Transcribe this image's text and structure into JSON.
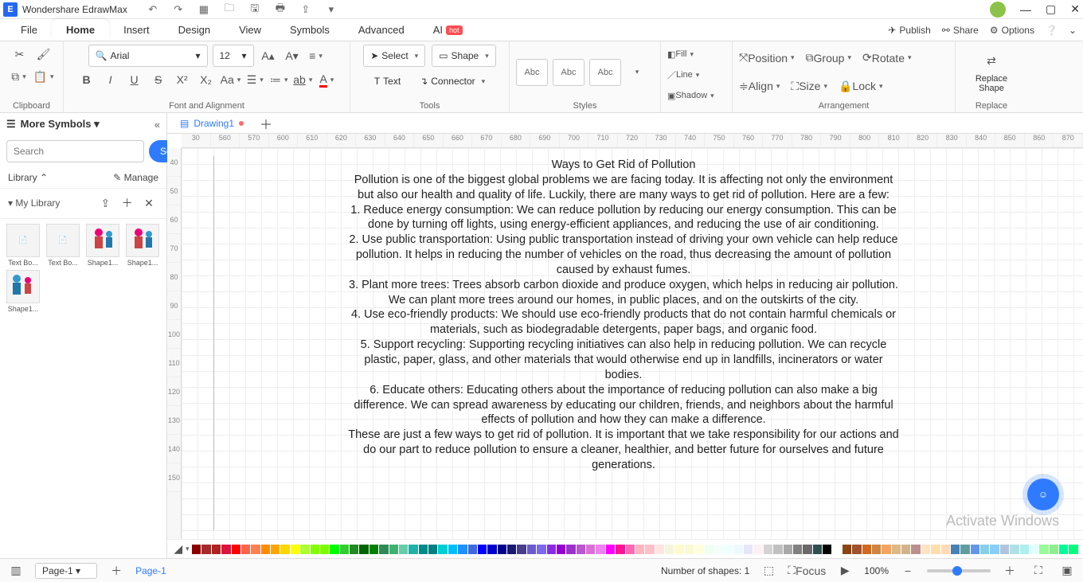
{
  "app": {
    "title": "Wondershare EdrawMax"
  },
  "window_controls": {
    "min": "—",
    "max": "▢",
    "close": "✕"
  },
  "menu": {
    "items": [
      "File",
      "Home",
      "Insert",
      "Design",
      "View",
      "Symbols",
      "Advanced",
      "AI"
    ],
    "active": "Home",
    "ai_badge": "hot",
    "right": {
      "publish": "Publish",
      "share": "Share",
      "options": "Options"
    }
  },
  "ribbon": {
    "clipboard": {
      "label": "Clipboard"
    },
    "font": {
      "label": "Font and Alignment",
      "name": "Arial",
      "size": "12"
    },
    "tools": {
      "label": "Tools",
      "select": "Select",
      "shape": "Shape",
      "text": "Text",
      "connector": "Connector"
    },
    "styles": {
      "label": "Styles",
      "items": [
        "Abc",
        "Abc",
        "Abc"
      ]
    },
    "shape_props": {
      "fill": "Fill",
      "line": "Line",
      "shadow": "Shadow"
    },
    "arrangement": {
      "label": "Arrangement",
      "position": "Position",
      "align": "Align",
      "group": "Group",
      "size": "Size",
      "rotate": "Rotate",
      "lock": "Lock"
    },
    "replace": {
      "label": "Replace",
      "btn": "Replace Shape"
    }
  },
  "sidebar": {
    "title": "More Symbols",
    "search_placeholder": "Search",
    "search_btn": "Search",
    "library": "Library",
    "manage": "Manage",
    "mylib": "My Library",
    "thumbs": [
      "Text Bo...",
      "Text Bo...",
      "Shape1...",
      "Shape1...",
      "Shape1..."
    ]
  },
  "doc_tabs": {
    "drawing": "Drawing1"
  },
  "ruler_h": [
    "30",
    "560",
    "570",
    "600",
    "610",
    "620",
    "630",
    "640",
    "650",
    "660",
    "670",
    "680",
    "690",
    "700",
    "710",
    "720",
    "730",
    "740",
    "750",
    "760",
    "770",
    "780",
    "790",
    "800",
    "810",
    "820",
    "830",
    "840",
    "850",
    "860",
    "870"
  ],
  "ruler_v": [
    "40",
    "50",
    "60",
    "70",
    "80",
    "90",
    "100",
    "110",
    "120",
    "130",
    "140",
    "150"
  ],
  "essay": {
    "title": "Ways to Get Rid of Pollution",
    "p1": "Pollution is one of the biggest global problems we are facing today. It is affecting not only the environment but also our health and quality of life. Luckily, there are many ways to get rid of pollution. Here are a few:",
    "p2": "1. Reduce energy consumption: We can reduce pollution by reducing our energy consumption. This can be done by turning off lights, using energy-efficient appliances, and reducing the use of air conditioning.",
    "p3": "2. Use public transportation: Using public transportation instead of driving your own vehicle can help reduce pollution. It helps in reducing the number of vehicles on the road, thus decreasing the amount of pollution caused by exhaust fumes.",
    "p4": "3. Plant more trees: Trees absorb carbon dioxide and produce oxygen, which helps in reducing air pollution. We can plant more trees around our homes, in public places, and on the outskirts of the city.",
    "p5": "4. Use eco-friendly products: We should use eco-friendly products that do not contain harmful chemicals or materials, such as biodegradable detergents, paper bags, and organic food.",
    "p6": "5. Support recycling: Supporting recycling initiatives can also help in reducing pollution. We can recycle plastic, paper, glass, and other materials that would otherwise end up in landfills, incinerators or water bodies.",
    "p7": "6. Educate others: Educating others about the importance of reducing pollution can also make a big difference. We can spread awareness by educating our children, friends, and neighbors about the harmful effects of pollution and how they can make a difference.",
    "p8": "These are just a few ways to get rid of pollution. It is important that we take responsibility for our actions and do our part to reduce pollution to ensure a cleaner, healthier, and better future for ourselves and future generations."
  },
  "watermark": "Activate Windows",
  "status": {
    "page_sel": "Page-1",
    "page_tab": "Page-1",
    "shapes_label": "Number of shapes:",
    "shapes_count": "1",
    "focus": "Focus",
    "zoom": "100%"
  },
  "colors": [
    "#8B0000",
    "#A52A2A",
    "#B22222",
    "#DC143C",
    "#FF0000",
    "#FF6347",
    "#FF7F50",
    "#FF8C00",
    "#FFA500",
    "#FFD700",
    "#FFFF00",
    "#ADFF2F",
    "#7FFF00",
    "#7CFC00",
    "#00FF00",
    "#32CD32",
    "#228B22",
    "#006400",
    "#008000",
    "#2E8B57",
    "#3CB371",
    "#66CDAA",
    "#20B2AA",
    "#008B8B",
    "#008080",
    "#00CED1",
    "#00BFFF",
    "#1E90FF",
    "#4169E1",
    "#0000FF",
    "#0000CD",
    "#00008B",
    "#191970",
    "#483D8B",
    "#6A5ACD",
    "#7B68EE",
    "#8A2BE2",
    "#9400D3",
    "#9932CC",
    "#BA55D3",
    "#DA70D6",
    "#EE82EE",
    "#FF00FF",
    "#FF1493",
    "#FF69B4",
    "#FFB6C1",
    "#FFC0CB",
    "#FFE4E1",
    "#F5F5DC",
    "#FFFACD",
    "#FAFAD2",
    "#FFFFE0",
    "#F0FFF0",
    "#F5FFFA",
    "#F0FFFF",
    "#F0F8FF",
    "#E6E6FA",
    "#FFF0F5",
    "#D3D3D3",
    "#C0C0C0",
    "#A9A9A9",
    "#808080",
    "#696969",
    "#2F4F4F",
    "#000000",
    "#FFFFFF",
    "#8B4513",
    "#A0522D",
    "#D2691E",
    "#CD853F",
    "#F4A460",
    "#DEB887",
    "#D2B48C",
    "#BC8F8F",
    "#FFE4C4",
    "#FFDEAD",
    "#FFDAB9",
    "#4682B4",
    "#5F9EA0",
    "#6495ED",
    "#87CEEB",
    "#87CEFA",
    "#B0C4DE",
    "#B0E0E6",
    "#AFEEEE",
    "#E0FFFF",
    "#98FB98",
    "#90EE90",
    "#00FA9A",
    "#00FF7F"
  ]
}
